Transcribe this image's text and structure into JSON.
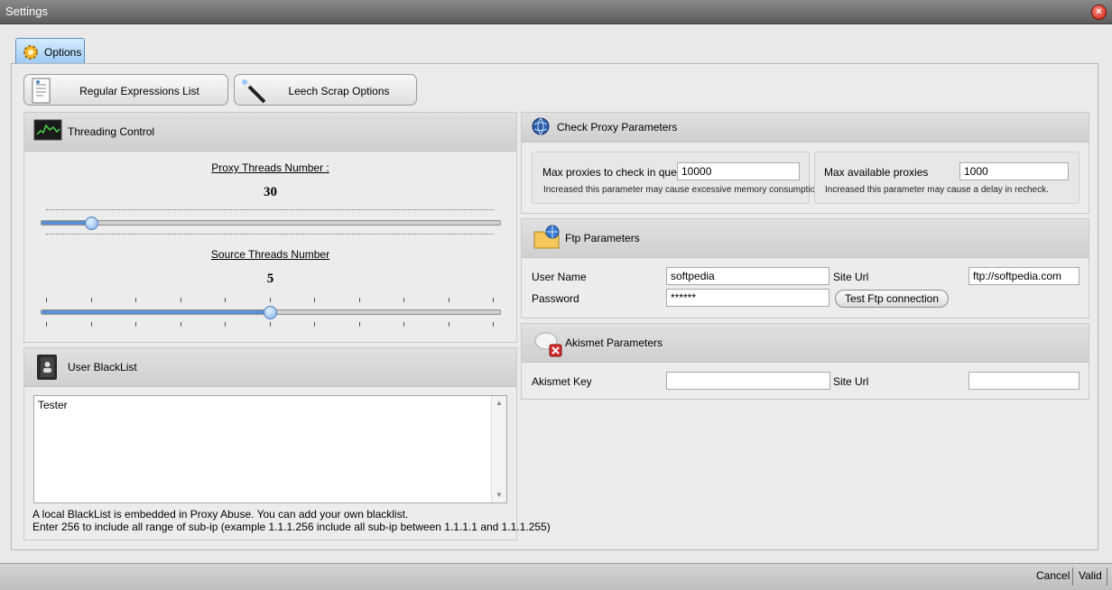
{
  "window": {
    "title": "Settings"
  },
  "tabs": [
    {
      "label": "Options"
    }
  ],
  "toolbar": {
    "regex_list_label": "Regular Expressions List",
    "leech_scrap_label": "Leech Scrap Options"
  },
  "threading": {
    "title": "Threading Control",
    "proxy_threads_label": "Proxy Threads Number :",
    "proxy_threads_value": "30",
    "proxy_threads_fraction": 0.11,
    "source_threads_label": "Source Threads Number",
    "source_threads_value": "5",
    "source_threads_fraction": 0.5
  },
  "blacklist": {
    "title": "User BlackList",
    "items": "Tester",
    "help_line1": "A local BlackList is embedded in Proxy Abuse. You can add your own blacklist.",
    "help_line2": "Enter 256 to include all range of sub-ip (example 1.1.1.256 include all sub-ip between 1.1.1.1 and 1.1.1.255)"
  },
  "check_proxy": {
    "title": "Check Proxy Parameters",
    "max_check_label": "Max proxies to check in queue",
    "max_check_value": "10000",
    "max_check_note": "Increased this parameter may cause excessive memory consumption",
    "max_available_label": "Max available proxies",
    "max_available_value": "1000",
    "max_available_note": "Increased this parameter may cause a delay in recheck."
  },
  "ftp": {
    "title": "Ftp Parameters",
    "user_label": "User Name",
    "user_value": "softpedia",
    "site_label": "Site Url",
    "site_value": "ftp://softpedia.com",
    "password_label": "Password",
    "password_value": "******",
    "test_button": "Test Ftp connection"
  },
  "akismet": {
    "title": "Akismet Parameters",
    "key_label": "Akismet Key",
    "key_value": "",
    "site_label": "Site Url",
    "site_value": ""
  },
  "statusbar": {
    "cancel": "Cancel",
    "valid": "Valid"
  }
}
